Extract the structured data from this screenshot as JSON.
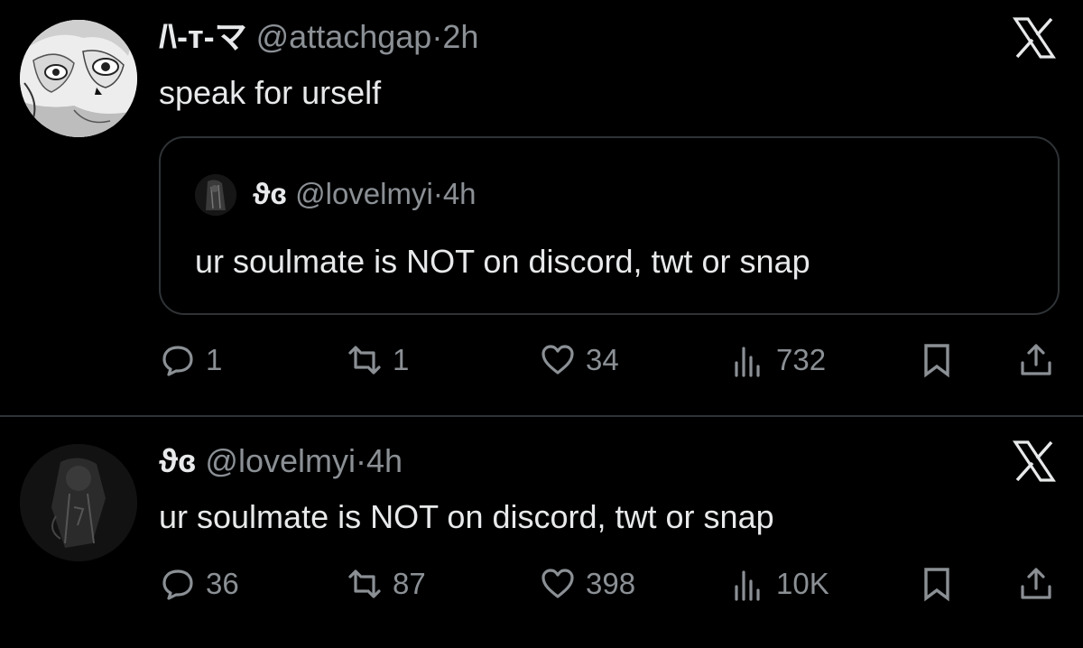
{
  "tweet1": {
    "display_name": "/\\-ᴛ-マ",
    "handle": "@attachgap",
    "separator": "·",
    "time": "2h",
    "text": "speak for urself",
    "quoted": {
      "display_name": "ϑɞ",
      "handle": "@lovelmyi",
      "separator": "·",
      "time": "4h",
      "text": "ur soulmate is NOT on discord, twt or snap"
    },
    "actions": {
      "replies": "1",
      "reposts": "1",
      "likes": "34",
      "views": "732"
    }
  },
  "tweet2": {
    "display_name": "ϑɞ",
    "handle": "@lovelmyi",
    "separator": "·",
    "time": "4h",
    "text": "ur soulmate is NOT on discord, twt or snap",
    "actions": {
      "replies": "36",
      "reposts": "87",
      "likes": "398",
      "views": "10K"
    }
  },
  "icons": {
    "brand": "x-logo-icon",
    "reply": "speech-bubble-icon",
    "repost": "repost-arrows-icon",
    "like": "heart-icon",
    "views": "bar-chart-icon",
    "bookmark": "bookmark-icon",
    "share": "share-upload-icon"
  },
  "colors": {
    "background": "#000000",
    "text": "#e7e9ea",
    "muted": "#8b9095",
    "border": "#2f3336"
  }
}
